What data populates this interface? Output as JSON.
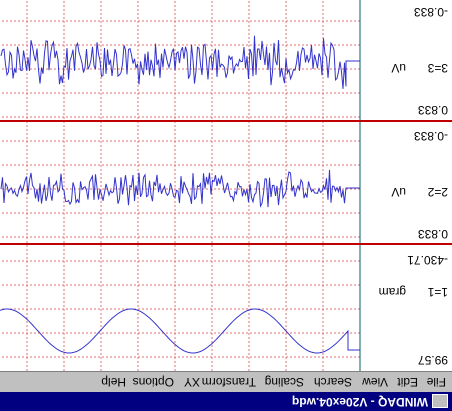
{
  "window": {
    "title": "WINDAQ - V20ex04.wdq"
  },
  "menu": {
    "items": [
      "File",
      "Edit",
      "View",
      "Search",
      "Scaling",
      "Transform",
      "XY",
      "Options",
      "Help"
    ]
  },
  "channels": [
    {
      "id_label": "1=1",
      "unit": "gram",
      "top_value": "99.57",
      "bottom_value": "-430.71"
    },
    {
      "id_label": "2=2",
      "unit": "uV",
      "top_value": "0.833",
      "bottom_value": "-0.833"
    },
    {
      "id_label": "3=3",
      "unit": "uV",
      "top_value": "0.833",
      "bottom_value": "-0.833"
    }
  ],
  "colors": {
    "trace": "#3333cc",
    "grid": "#e07070",
    "divider": "#c00000",
    "title_bg": "#000080"
  }
}
